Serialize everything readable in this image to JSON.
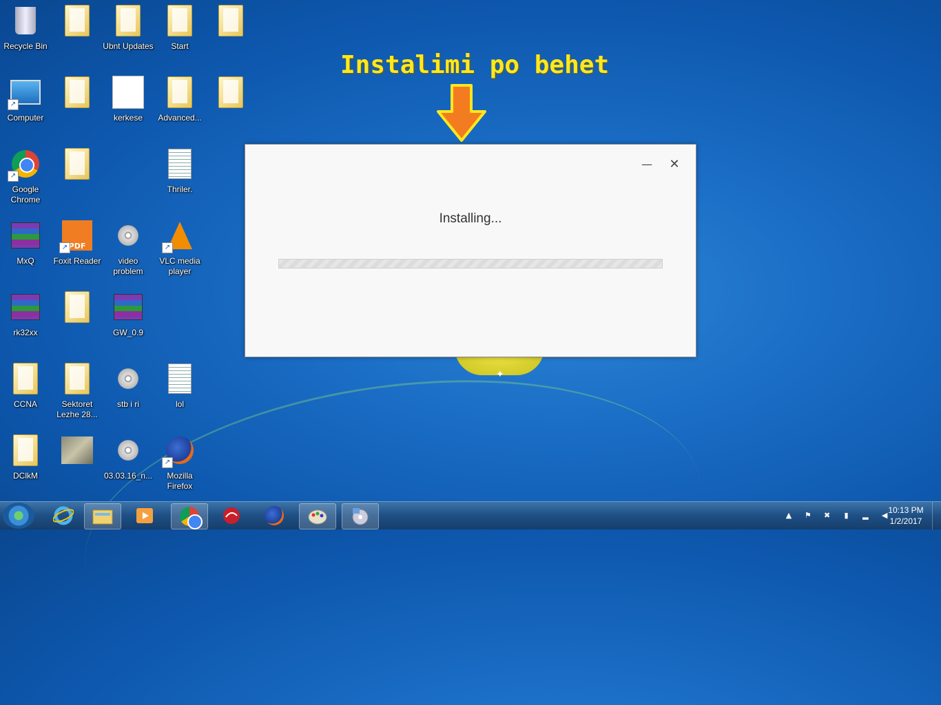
{
  "annotation": {
    "text": "Instalimi po behet"
  },
  "desktop_icons": [
    {
      "label": "Recycle Bin"
    },
    {
      "label": ""
    },
    {
      "label": "Ubnt Updates"
    },
    {
      "label": "Start"
    },
    {
      "label": ""
    },
    {
      "label": "Computer"
    },
    {
      "label": ""
    },
    {
      "label": "kerkese"
    },
    {
      "label": "Advanced..."
    },
    {
      "label": ""
    },
    {
      "label": "Google Chrome"
    },
    {
      "label": ""
    },
    {
      "label": "Thriler."
    },
    {
      "label": "MxQ"
    },
    {
      "label": "Foxit Reader"
    },
    {
      "label": "video problem"
    },
    {
      "label": "VLC media player"
    },
    {
      "label": "rk32xx"
    },
    {
      "label": ""
    },
    {
      "label": "GW_0.9"
    },
    {
      "label": "CCNA"
    },
    {
      "label": "Sektoret Lezhe 28..."
    },
    {
      "label": "stb i ri"
    },
    {
      "label": "lol"
    },
    {
      "label": "DClkM"
    },
    {
      "label": ""
    },
    {
      "label": "03.03.16_n..."
    },
    {
      "label": "Mozilla Firefox"
    }
  ],
  "dialog": {
    "status_text": "Installing...",
    "progress": 0.0,
    "minimize_glyph": "—",
    "close_glyph": "✕"
  },
  "taskbar": {
    "items": [
      {
        "icon": "internet-explorer-icon"
      },
      {
        "icon": "windows-explorer-icon"
      },
      {
        "icon": "media-player-icon"
      },
      {
        "icon": "chrome-icon"
      },
      {
        "icon": "red-app-icon"
      },
      {
        "icon": "firefox-icon"
      },
      {
        "icon": "paint-icon"
      },
      {
        "icon": "dvd-maker-icon"
      }
    ],
    "clock": {
      "time": "10:13 PM",
      "date": "1/2/2017"
    }
  },
  "colors": {
    "annotation": "#ffe81c",
    "arrow": "#f47c20",
    "progress_track": "#e3e3e3"
  }
}
